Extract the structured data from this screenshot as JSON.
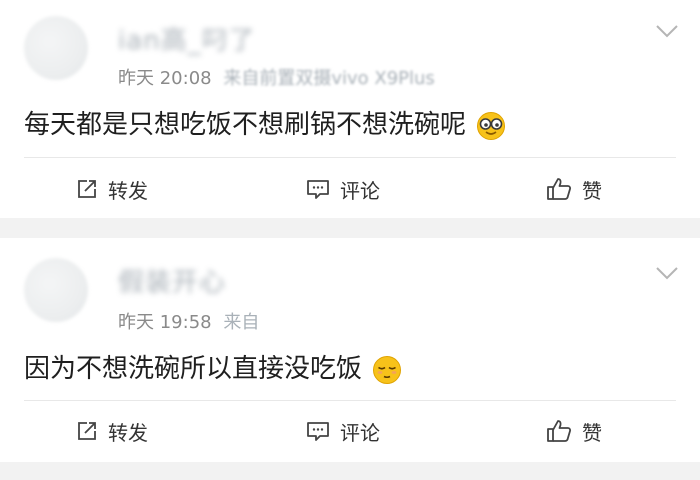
{
  "posts": [
    {
      "username": "ian高_叼了",
      "time": "昨天 20:08",
      "source": "来自前置双摄vivo X9Plus",
      "content": "每天都是只想吃饭不想刷锅不想洗碗呢",
      "emoji": "nerd-face-emoji",
      "actions": {
        "repost": "转发",
        "comment": "评论",
        "like": "赞"
      }
    },
    {
      "username": "假装开心",
      "time": "昨天 19:58",
      "source": "来自",
      "content": "因为不想洗碗所以直接没吃饭",
      "emoji": "relieved-face-emoji",
      "actions": {
        "repost": "转发",
        "comment": "评论",
        "like": "赞"
      }
    }
  ],
  "colors": {
    "background": "#f2f2f2",
    "card": "#ffffff",
    "meta": "#8a8a8a",
    "text": "#1f1f1f",
    "divider": "#e8e8e8",
    "emoji": "#f7c21a"
  }
}
